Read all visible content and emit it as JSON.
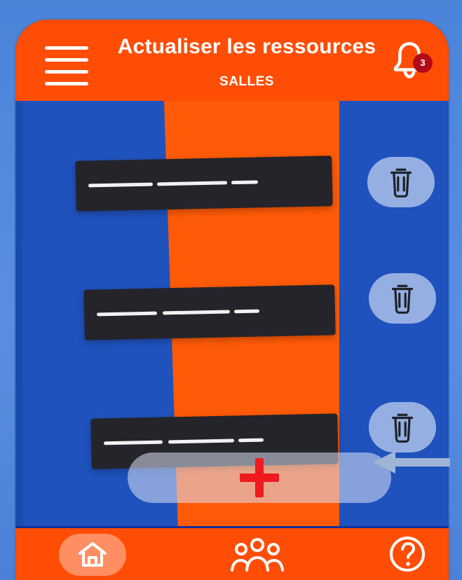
{
  "app": {
    "title": "Actualiser les ressources",
    "subtitle": "SALLES"
  },
  "header": {
    "menu_icon": "menu-icon",
    "notification_icon": "bell-icon",
    "notification_count": "3"
  },
  "resources": {
    "items": [
      {
        "redacted_segments": [
          "redacted-text",
          "redacted-text",
          "redacted-text"
        ],
        "action_icon": "trash-icon"
      },
      {
        "redacted_segments": [
          "redacted-text",
          "redacted-text",
          "redacted-text"
        ],
        "action_icon": "trash-icon"
      },
      {
        "redacted_segments": [
          "redacted-text",
          "redacted-text",
          "redacted-text"
        ],
        "action_icon": "trash-icon"
      }
    ]
  },
  "actions": {
    "add_icon": "plus-icon"
  },
  "annotation": {
    "pointer_icon": "arrow-left-icon"
  },
  "bottom_nav": {
    "items": [
      {
        "icon": "home-icon",
        "active": true
      },
      {
        "icon": "people-icon",
        "active": false
      },
      {
        "icon": "help-icon",
        "active": false
      }
    ]
  },
  "colors": {
    "background": "#4f86d8",
    "blue": "#1f52bd",
    "orange": "#ff4d05",
    "row": "#24242a",
    "badge": "#b10b1a",
    "plus": "#ee1a1e"
  }
}
